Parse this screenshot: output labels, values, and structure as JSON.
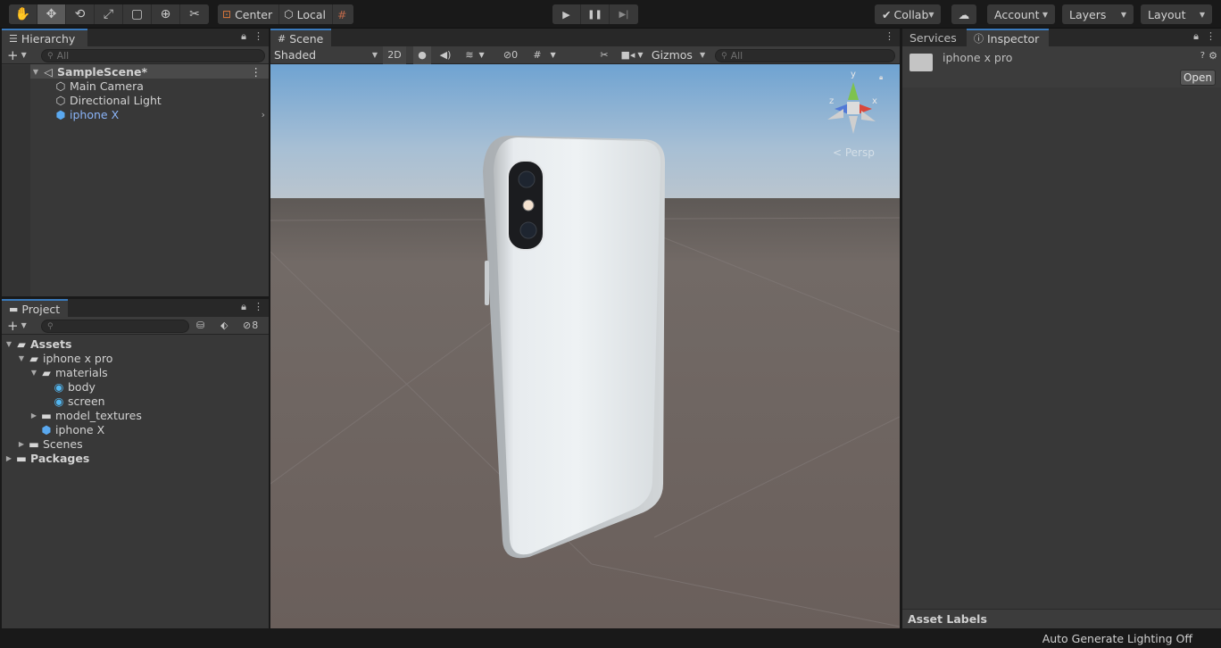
{
  "toolbar": {
    "tools": [
      "hand-tool",
      "move-tool",
      "rotate-tool",
      "scale-tool",
      "rect-tool",
      "transform-tool",
      "custom-tool"
    ],
    "pivot_label": "Center",
    "space_label": "Local",
    "collab_label": "Collab",
    "account_label": "Account",
    "layers_label": "Layers",
    "layout_label": "Layout"
  },
  "hierarchy": {
    "tab_label": "Hierarchy",
    "search_placeholder": "All",
    "scene_name": "SampleScene*",
    "items": [
      {
        "label": "Main Camera"
      },
      {
        "label": "Directional Light"
      },
      {
        "label": "iphone X"
      }
    ]
  },
  "project": {
    "tab_label": "Project",
    "hidden_count": "8",
    "tree": {
      "assets": "Assets",
      "iphone_x_pro": "iphone x pro",
      "materials": "materials",
      "body": "body",
      "screen": "screen",
      "model_textures": "model_textures",
      "iphone_x": "iphone X",
      "scenes": "Scenes",
      "packages": "Packages"
    }
  },
  "scene": {
    "tab_label": "Scene",
    "shading_mode": "Shaded",
    "mode_2d": "2D",
    "fx_count": "0",
    "gizmos_label": "Gizmos",
    "search_placeholder": "All",
    "axis_labels": {
      "y": "y",
      "z": "z",
      "x": "x"
    },
    "persp_label": "< Persp"
  },
  "inspector": {
    "tab_services": "Services",
    "tab_inspector": "Inspector",
    "asset_name": "iphone x pro",
    "open_button": "Open",
    "asset_labels": "Asset Labels"
  },
  "status": {
    "lighting": "Auto Generate Lighting Off"
  },
  "colors": {
    "accent_blue": "#3a79bb",
    "selected_text": "#8ab4f8",
    "panel_bg": "#383838",
    "toolbar_bg": "#191919"
  }
}
